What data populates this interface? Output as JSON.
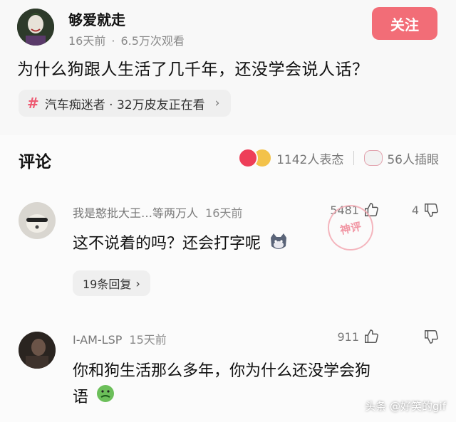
{
  "post": {
    "author": "够爱就走",
    "time": "16天前",
    "views": "6.5万次观看",
    "follow_label": "关注",
    "title": "为什么狗跟人生活了几千年，还没学会说人话？",
    "topic": "汽车痴迷者 · 32万皮友正在看",
    "topic_icon": "hash-icon"
  },
  "comments_section": {
    "title": "评论",
    "reactions_text": "1142人表态",
    "insert_images_text": "56人插眼"
  },
  "comments": [
    {
      "author": "我是憨批大王…等两万人",
      "time": "16天前",
      "likes": "5481",
      "dislikes": "4",
      "text": "这不说着的吗？还会打字呢",
      "replies_label": "19条回复",
      "stamp": "神评"
    },
    {
      "author": "I-AM-LSP",
      "time": "15天前",
      "likes": "911",
      "dislikes": "",
      "text_line1": "你和狗生活那么多年，你为什么还没学会狗",
      "text_line2": "语"
    }
  ],
  "watermark": "头条 @好笑的gif",
  "colors": {
    "accent": "#f26d77",
    "topic_hash": "#ee5a72"
  }
}
